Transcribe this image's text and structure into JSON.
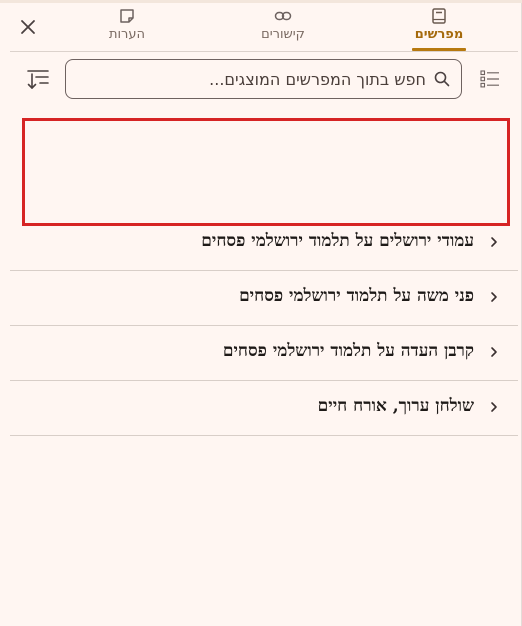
{
  "tabs": [
    {
      "label": "מפרשים",
      "icon": "book-icon",
      "active": true
    },
    {
      "label": "קישורים",
      "icon": "link-icon",
      "active": false
    },
    {
      "label": "הערות",
      "icon": "sticky-note-icon",
      "active": false
    }
  ],
  "toolbar": {
    "search_placeholder": "חפש בתוך המפרשים המוצגים...",
    "search_value": "",
    "sort_icon": "sort-descending-icon",
    "list_view_icon": "list-view-icon",
    "close_icon": "close-icon"
  },
  "commentaries": [
    {
      "title": "עמודי ירושלים על תלמוד ירושלמי פסחים"
    },
    {
      "title": "פני משה על תלמוד ירושלמי פסחים"
    },
    {
      "title": "קרבן העדה על תלמוד ירושלמי פסחים"
    },
    {
      "title": "שולחן ערוך, אורח חיים"
    }
  ],
  "colors": {
    "background": "#fff6f2",
    "accent": "#b7790f",
    "highlight_border": "#d62424",
    "text": "#1e1a18"
  }
}
